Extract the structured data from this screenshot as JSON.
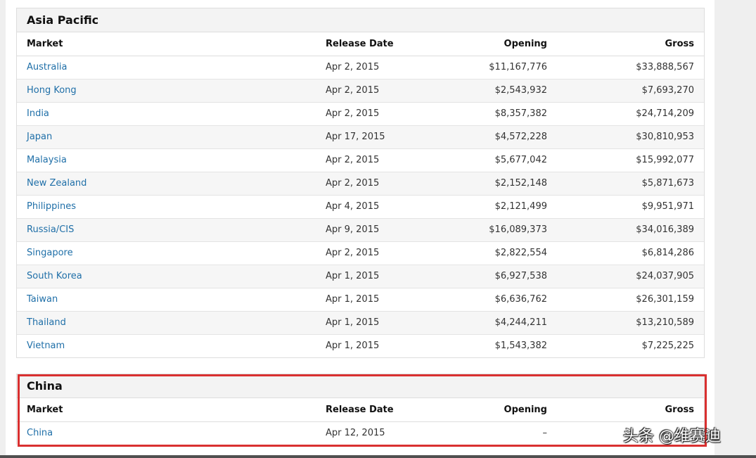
{
  "columns": {
    "market": "Market",
    "release_date": "Release Date",
    "opening": "Opening",
    "gross": "Gross"
  },
  "regions": [
    {
      "title": "Asia Pacific",
      "rows": [
        {
          "market": "Australia",
          "release_date": "Apr 2, 2015",
          "opening": "$11,167,776",
          "gross": "$33,888,567"
        },
        {
          "market": "Hong Kong",
          "release_date": "Apr 2, 2015",
          "opening": "$2,543,932",
          "gross": "$7,693,270"
        },
        {
          "market": "India",
          "release_date": "Apr 2, 2015",
          "opening": "$8,357,382",
          "gross": "$24,714,209"
        },
        {
          "market": "Japan",
          "release_date": "Apr 17, 2015",
          "opening": "$4,572,228",
          "gross": "$30,810,953"
        },
        {
          "market": "Malaysia",
          "release_date": "Apr 2, 2015",
          "opening": "$5,677,042",
          "gross": "$15,992,077"
        },
        {
          "market": "New Zealand",
          "release_date": "Apr 2, 2015",
          "opening": "$2,152,148",
          "gross": "$5,871,673"
        },
        {
          "market": "Philippines",
          "release_date": "Apr 4, 2015",
          "opening": "$2,121,499",
          "gross": "$9,951,971"
        },
        {
          "market": "Russia/CIS",
          "release_date": "Apr 9, 2015",
          "opening": "$16,089,373",
          "gross": "$34,016,389"
        },
        {
          "market": "Singapore",
          "release_date": "Apr 2, 2015",
          "opening": "$2,822,554",
          "gross": "$6,814,286"
        },
        {
          "market": "South Korea",
          "release_date": "Apr 1, 2015",
          "opening": "$6,927,538",
          "gross": "$24,037,905"
        },
        {
          "market": "Taiwan",
          "release_date": "Apr 1, 2015",
          "opening": "$6,636,762",
          "gross": "$26,301,159"
        },
        {
          "market": "Thailand",
          "release_date": "Apr 1, 2015",
          "opening": "$4,244,211",
          "gross": "$13,210,589"
        },
        {
          "market": "Vietnam",
          "release_date": "Apr 1, 2015",
          "opening": "$1,543,382",
          "gross": "$7,225,225"
        }
      ]
    },
    {
      "title": "China",
      "rows": [
        {
          "market": "China",
          "release_date": "Apr 12, 2015",
          "opening": "–",
          "gross": ""
        }
      ]
    }
  ],
  "watermark": "头条 @维赛迪",
  "colors": {
    "link": "#1f6fa8",
    "highlight_border": "#d93030",
    "header_bg": "#f3f3f3",
    "stripe_bg": "#f6f6f6"
  }
}
